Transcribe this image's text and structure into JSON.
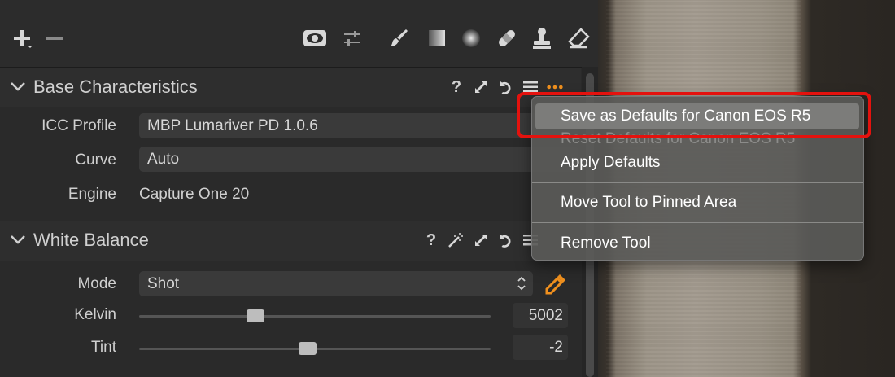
{
  "toolbar": {
    "icons": [
      "add-icon",
      "remove-icon",
      "eye-icon",
      "adjust-icon",
      "brush-icon",
      "gradient-icon",
      "radial-icon",
      "heal-icon",
      "clone-stamp-icon",
      "eraser-icon"
    ]
  },
  "base_characteristics": {
    "title": "Base Characteristics",
    "header_icons": [
      "help-icon",
      "expand-icon",
      "reset-icon",
      "presets-icon",
      "more-icon"
    ],
    "icc_profile_label": "ICC Profile",
    "icc_profile_value": "MBP Lumariver PD 1.0.6",
    "curve_label": "Curve",
    "curve_value": "Auto",
    "engine_label": "Engine",
    "engine_value": "Capture One 20"
  },
  "white_balance": {
    "title": "White Balance",
    "header_icons": [
      "help-icon",
      "magic-wand-icon",
      "expand-icon",
      "reset-icon",
      "presets-icon"
    ],
    "mode_label": "Mode",
    "mode_value": "Shot",
    "kelvin_label": "Kelvin",
    "kelvin_value": "5002",
    "tint_label": "Tint",
    "tint_value": "-2",
    "kelvin_slider_level": 0.33,
    "tint_slider_level": 0.48
  },
  "context_menu": {
    "items": [
      {
        "label": "Save as Defaults for Canon EOS R5",
        "state": "highlighted"
      },
      {
        "label": "Reset Defaults for Canon EOS R5",
        "state": "disabled"
      },
      {
        "label": "Apply Defaults",
        "state": "enabled"
      },
      {
        "label": "Move Tool to Pinned Area",
        "state": "enabled"
      },
      {
        "label": "Remove Tool",
        "state": "enabled"
      }
    ]
  },
  "colors": {
    "accent_orange": "#f0901e",
    "annotation_red": "#e4120e"
  }
}
